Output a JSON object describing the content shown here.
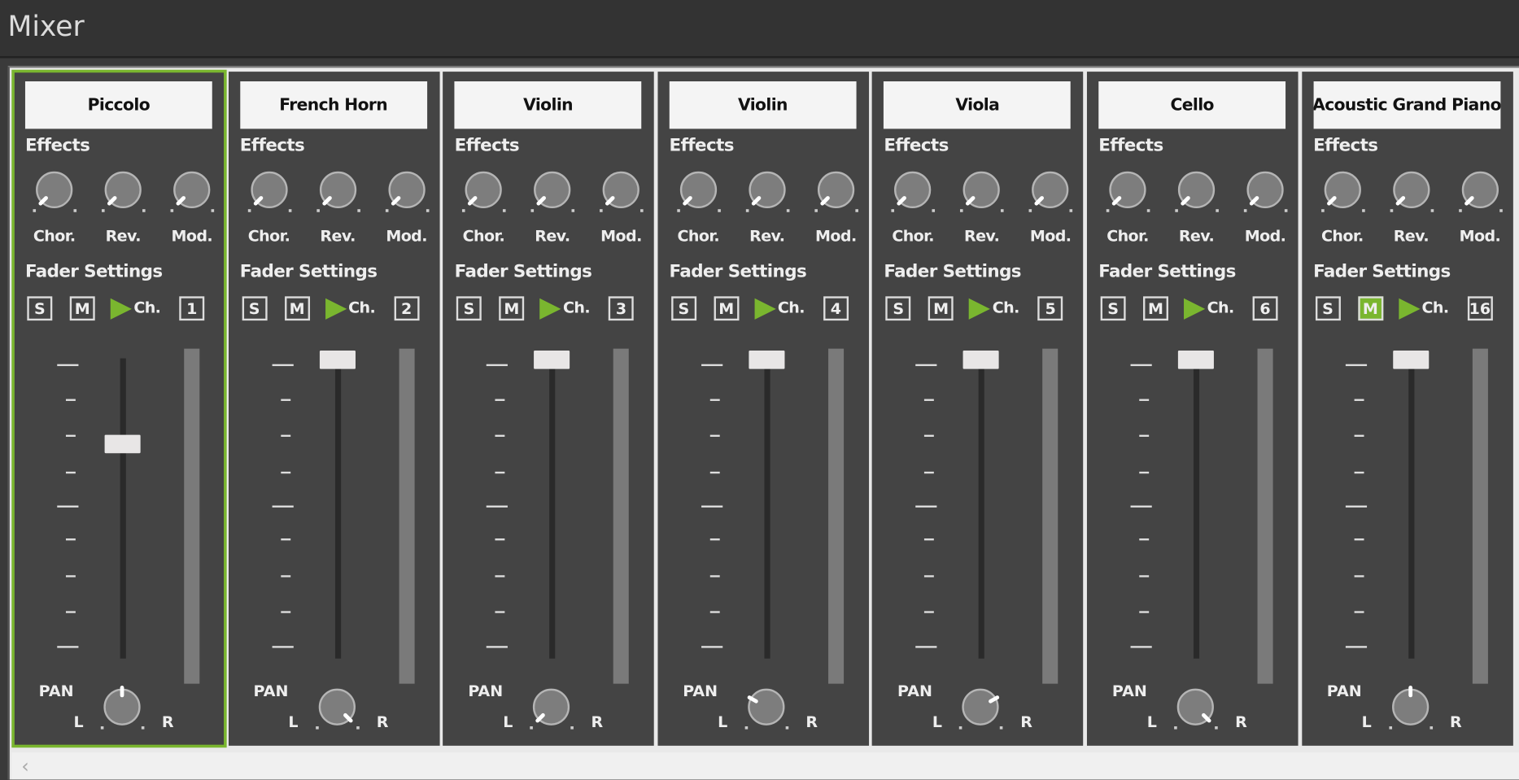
{
  "window": {
    "title": "Mixer"
  },
  "colors": {
    "accent": "#7ab62f",
    "strip_bg": "#444444",
    "meter": "#7a7a7a"
  },
  "labels": {
    "effects": "Effects",
    "chorus": "Chor.",
    "reverb": "Rev.",
    "modulation": "Mod.",
    "fader_settings": "Fader Settings",
    "solo": "S",
    "mute": "M",
    "channel": "Ch.",
    "pan": "PAN",
    "left": "L",
    "right": "R"
  },
  "scrollbar": {
    "left_arrow": "‹"
  },
  "strips": [
    {
      "name": "Piccolo",
      "channel": "1",
      "selected": true,
      "muted": false,
      "soloed": false,
      "fader": 0.72,
      "pan": 0.0,
      "effects": {
        "chorus": 0,
        "reverb": 0,
        "modulation": 0
      }
    },
    {
      "name": "French Horn",
      "channel": "2",
      "selected": false,
      "muted": false,
      "soloed": false,
      "fader": 1.0,
      "pan": 1.0,
      "effects": {
        "chorus": 0,
        "reverb": 0,
        "modulation": 0
      }
    },
    {
      "name": "Violin",
      "channel": "3",
      "selected": false,
      "muted": false,
      "soloed": false,
      "fader": 1.0,
      "pan": -1.0,
      "effects": {
        "chorus": 0,
        "reverb": 0,
        "modulation": 0
      }
    },
    {
      "name": "Violin",
      "channel": "4",
      "selected": false,
      "muted": false,
      "soloed": false,
      "fader": 1.0,
      "pan": -0.45,
      "effects": {
        "chorus": 0,
        "reverb": 0,
        "modulation": 0
      }
    },
    {
      "name": "Viola",
      "channel": "5",
      "selected": false,
      "muted": false,
      "soloed": false,
      "fader": 1.0,
      "pan": 0.45,
      "effects": {
        "chorus": 0,
        "reverb": 0,
        "modulation": 0
      }
    },
    {
      "name": "Cello",
      "channel": "6",
      "selected": false,
      "muted": false,
      "soloed": false,
      "fader": 1.0,
      "pan": 1.0,
      "effects": {
        "chorus": 0,
        "reverb": 0,
        "modulation": 0
      }
    },
    {
      "name": "Acoustic Grand Piano",
      "channel": "16",
      "selected": false,
      "muted": true,
      "soloed": false,
      "fader": 1.0,
      "pan": 0.0,
      "effects": {
        "chorus": 0,
        "reverb": 0,
        "modulation": 0
      }
    }
  ]
}
